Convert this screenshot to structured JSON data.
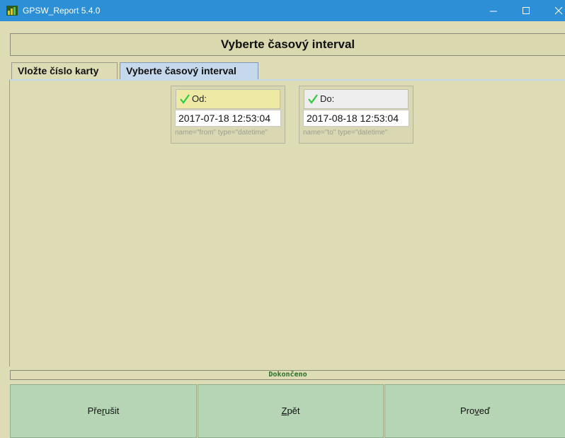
{
  "window": {
    "title": "GPSW_Report 5.4.0"
  },
  "header": {
    "title": "Vyberte časový interval"
  },
  "tabs": [
    {
      "label": "Vložte číslo karty",
      "active": false
    },
    {
      "label": "Vyberte časový interval",
      "active": true
    }
  ],
  "fields": {
    "from": {
      "label": "Od:",
      "value": "2017-07-18 12:53:04",
      "meta": "name=\"from\" type=\"datetime\""
    },
    "to": {
      "label": "Do:",
      "value": "2017-08-18 12:53:04",
      "meta": "name=\"to\" type=\"datetime\""
    }
  },
  "status": {
    "text": "Dokončeno"
  },
  "buttons": {
    "cancel": {
      "pre": "Pře",
      "accel": "r",
      "post": "ušit"
    },
    "back": {
      "pre": "",
      "accel": "Z",
      "post": "pět"
    },
    "run": {
      "pre": "Pro",
      "accel": "v",
      "post": "eď"
    }
  },
  "colors": {
    "titlebar": "#2d8fd6",
    "background": "#dddcb5",
    "active_tab": "#c6d9ec",
    "from_label": "#efe9a6",
    "check": "#2ecc40",
    "button": "#b5d5b5",
    "status_text": "#2a6f2a"
  },
  "icons": {
    "app": "bar-chart-icon",
    "check": "check-icon"
  }
}
